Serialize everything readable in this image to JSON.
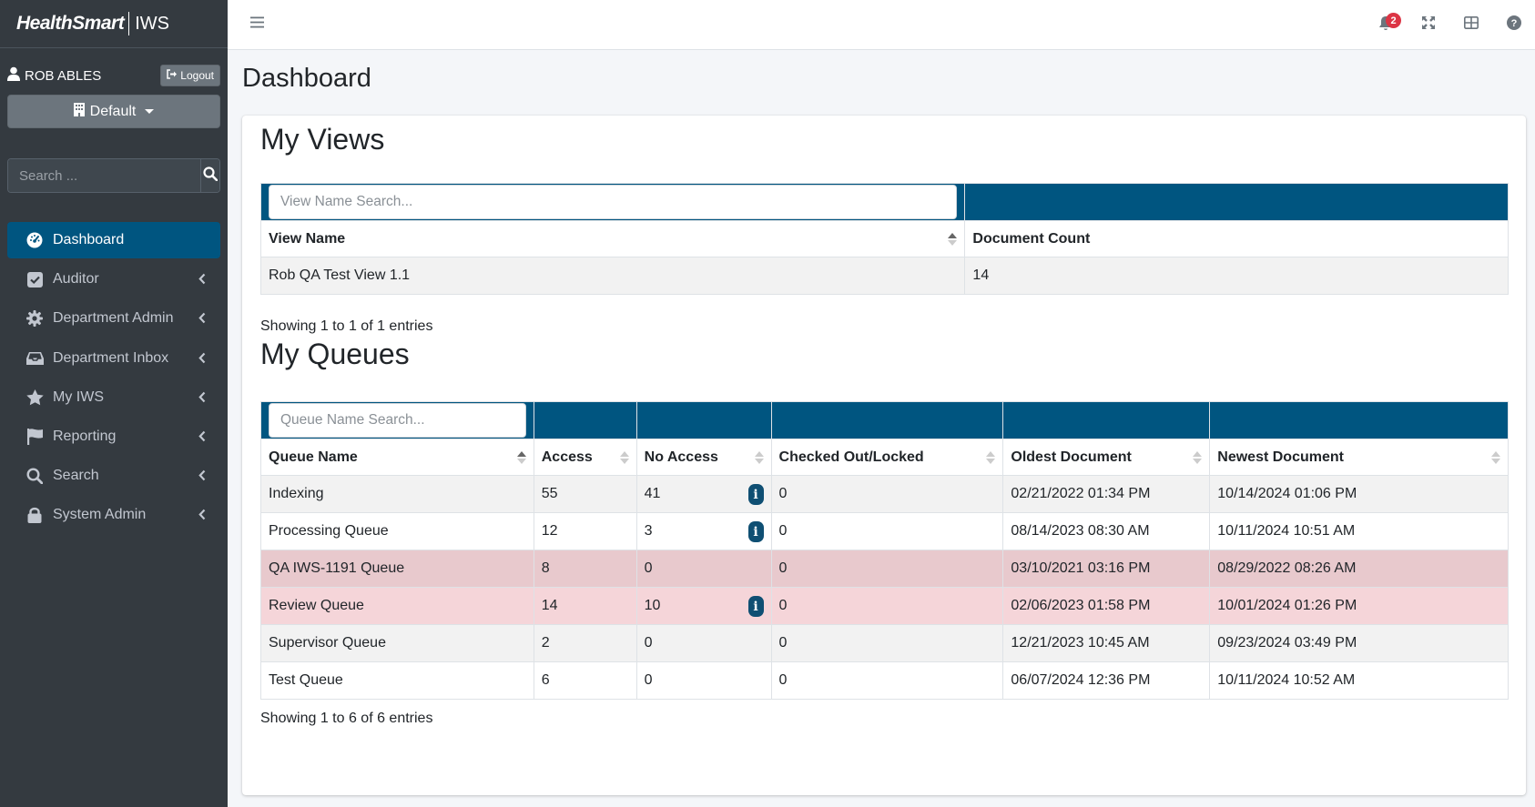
{
  "brand": {
    "logo": "HealthSmart",
    "product": "IWS"
  },
  "user": {
    "name": "ROB ABLES",
    "logout_label": "Logout"
  },
  "context_button": {
    "label": "Default"
  },
  "sidebar_search": {
    "placeholder": "Search ..."
  },
  "nav": {
    "items": [
      {
        "label": "Dashboard",
        "icon": "dashboard-icon",
        "active": true
      },
      {
        "label": "Auditor",
        "icon": "check-square-icon"
      },
      {
        "label": "Department Admin",
        "icon": "gear-icon"
      },
      {
        "label": "Department Inbox",
        "icon": "inbox-icon"
      },
      {
        "label": "My IWS",
        "icon": "star-icon"
      },
      {
        "label": "Reporting",
        "icon": "flag-icon"
      },
      {
        "label": "Search",
        "icon": "search-icon"
      },
      {
        "label": "System Admin",
        "icon": "lock-icon"
      }
    ]
  },
  "topbar": {
    "notification_count": "2"
  },
  "page": {
    "title": "Dashboard"
  },
  "views": {
    "title": "My Views",
    "search_placeholder": "View Name Search...",
    "columns": [
      "View Name",
      "Document Count"
    ],
    "rows": [
      [
        "Rob QA Test View 1.1",
        "14"
      ]
    ],
    "footer": "Showing 1 to 1 of 1 entries"
  },
  "queues": {
    "title": "My Queues",
    "search_placeholder": "Queue Name Search...",
    "columns": [
      "Queue Name",
      "Access",
      "No Access",
      "Checked Out/Locked",
      "Oldest Document",
      "Newest Document"
    ],
    "rows": [
      [
        "Indexing",
        "55",
        "41",
        "0",
        "02/21/2022 01:34 PM",
        "10/14/2024 01:06 PM"
      ],
      [
        "Processing Queue",
        "12",
        "3",
        "0",
        "08/14/2023 08:30 AM",
        "10/11/2024 10:51 AM"
      ],
      [
        "QA IWS-1191 Queue",
        "8",
        "0",
        "0",
        "03/10/2021 03:16 PM",
        "08/29/2022 08:26 AM"
      ],
      [
        "Review Queue",
        "14",
        "10",
        "0",
        "02/06/2023 01:58 PM",
        "10/01/2024 01:26 PM"
      ],
      [
        "Supervisor Queue",
        "2",
        "0",
        "0",
        "12/21/2023 10:45 AM",
        "09/23/2024 03:49 PM"
      ],
      [
        "Test Queue",
        "6",
        "0",
        "0",
        "06/07/2024 12:36 PM",
        "10/11/2024 10:52 AM"
      ]
    ],
    "footer": "Showing 1 to 6 of 6 entries"
  },
  "colors": {
    "sidebar": "#343a40",
    "accent": "#005580",
    "info": "#0f4f73",
    "row_danger": "#e8c9cd",
    "row_danger_light": "#f5d5d9",
    "badge": "#dc3545"
  }
}
